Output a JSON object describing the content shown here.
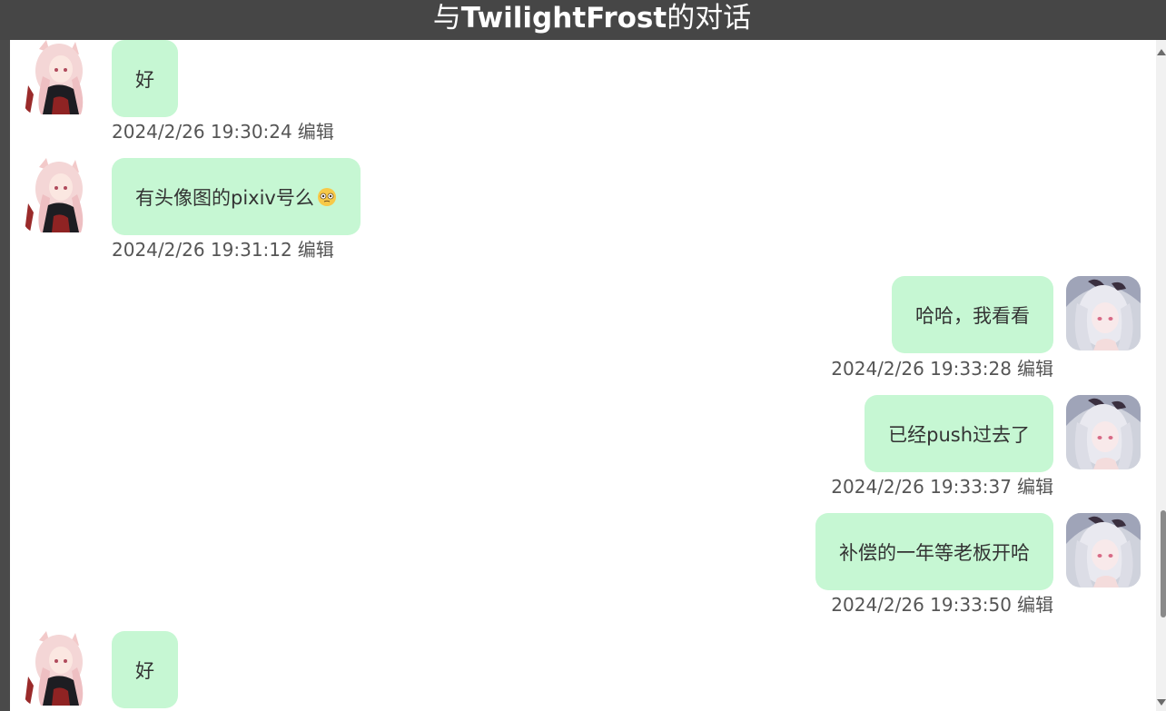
{
  "window": {
    "title_prefix": "与",
    "title_name": "TwilightFrost",
    "title_suffix": "的对话"
  },
  "messages": [
    {
      "side": "left",
      "text": "好",
      "timestamp": "2024/2/26 19:30:24",
      "edit_label": "编辑",
      "avatar": "pink-hair-girl-avatar"
    },
    {
      "side": "left",
      "text": "有头像图的pixiv号么",
      "emoji": "flushed-face-emoji",
      "timestamp": "2024/2/26 19:31:12",
      "edit_label": "编辑",
      "avatar": "pink-hair-girl-avatar"
    },
    {
      "side": "right",
      "text": "哈哈，我看看",
      "timestamp": "2024/2/26 19:33:28",
      "edit_label": "编辑",
      "avatar": "silver-hair-girl-avatar"
    },
    {
      "side": "right",
      "text": "已经push过去了",
      "timestamp": "2024/2/26 19:33:37",
      "edit_label": "编辑",
      "avatar": "silver-hair-girl-avatar"
    },
    {
      "side": "right",
      "text": "补偿的一年等老板开哈",
      "timestamp": "2024/2/26 19:33:50",
      "edit_label": "编辑",
      "avatar": "silver-hair-girl-avatar"
    },
    {
      "side": "left",
      "text": "好",
      "timestamp": "",
      "edit_label": "",
      "avatar": "pink-hair-girl-avatar"
    }
  ],
  "colors": {
    "header_bg": "#464646",
    "bubble_bg": "#c6f7d3",
    "text": "#333333",
    "meta_text": "#555555"
  }
}
